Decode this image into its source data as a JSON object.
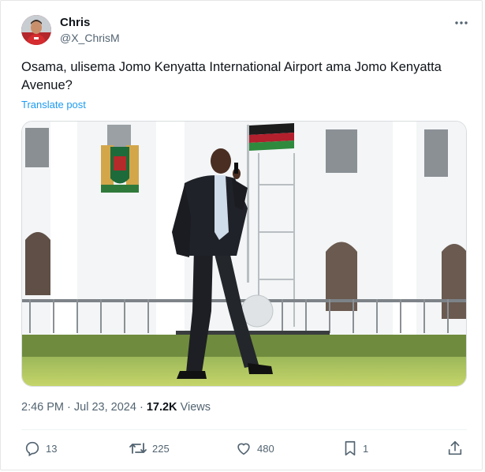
{
  "author": {
    "name": "Chris",
    "handle": "@X_ChrisM",
    "avatar_icon": "avatar-photo"
  },
  "post": {
    "text": "Osama, ulisema Jomo Kenyatta International Airport ama Jomo Kenyatta Avenue?",
    "translate_label": "Translate post",
    "image_icon": "photo-man-walking-on-lawn"
  },
  "meta": {
    "time": "2:46 PM",
    "separator": "·",
    "date": "Jul 23, 2024",
    "views_count": "17.2K",
    "views_label": "Views"
  },
  "actions": {
    "replies": "13",
    "reposts": "225",
    "likes": "480",
    "bookmarks": "1"
  },
  "colors": {
    "text": "#0f1419",
    "secondary": "#536471",
    "link": "#1d9bf0"
  }
}
